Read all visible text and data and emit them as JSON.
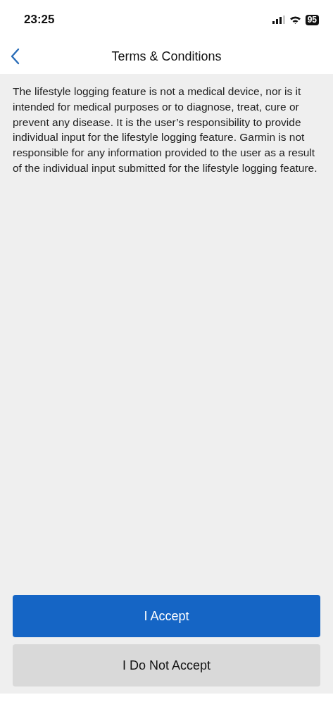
{
  "status_bar": {
    "time": "23:25",
    "battery": "95"
  },
  "header": {
    "title": "Terms & Conditions"
  },
  "body": "The lifestyle logging feature is not a medical device, nor is it intended for medical purposes or to diagnose, treat, cure or prevent any disease. It is the user’s responsibility to provide individual input for the lifestyle logging feature. Garmin is not responsible for any information provided to the user as a result of the individual input submitted for the lifestyle logging feature.",
  "buttons": [
    {
      "label": "I Accept",
      "kind": "primary"
    },
    {
      "label": "I Do Not Accept",
      "kind": "secondary"
    }
  ]
}
